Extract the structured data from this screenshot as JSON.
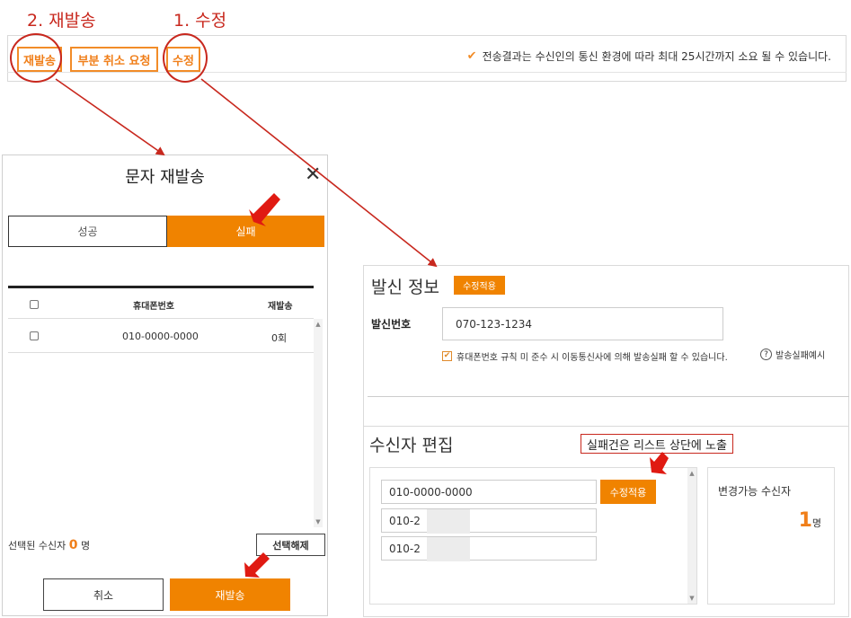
{
  "annotations": {
    "step2": "2. 재발송",
    "step1": "1. 수정",
    "callout": "실패건은 리스트 상단에 노출"
  },
  "toolbar": {
    "resend": "재발송",
    "partial_cancel": "부분 취소 요청",
    "edit": "수정",
    "notice": "전송결과는 수신인의 통신 환경에 따라 최대 25시간까지 소요 될 수 있습니다.",
    "notice_icon": "check-icon"
  },
  "modal": {
    "title": "문자 재발송",
    "close_icon": "close-icon",
    "tabs": {
      "success": "성공",
      "fail": "실패",
      "active": "fail"
    },
    "columns": {
      "phone": "휴대폰번호",
      "resend": "재발송"
    },
    "rows": [
      {
        "phone": "010-0000-0000",
        "count": "0회"
      }
    ],
    "selected_label": "선택된 수신자",
    "selected_count": "0",
    "selected_unit": "명",
    "clear_button": "선택해제",
    "cancel_button": "취소",
    "resend_button": "재발송"
  },
  "sender": {
    "title": "발신 정보",
    "apply": "수정적용",
    "label": "발신번호",
    "number": "070-123-1234",
    "warning": "휴대폰번호 규칙 미 준수 시 이동통신사에 의해 발송실패 할 수 있습니다.",
    "help": "발송실패예시"
  },
  "recipients": {
    "title": "수신자 편집",
    "entries": [
      "010-0000-0000",
      "010-2",
      "010-2"
    ],
    "apply": "수정적용",
    "editable_label": "변경가능 수신자",
    "editable_count": "1",
    "editable_unit": "명"
  },
  "colors": {
    "accent": "#f08300",
    "annotation": "#c8281e"
  }
}
